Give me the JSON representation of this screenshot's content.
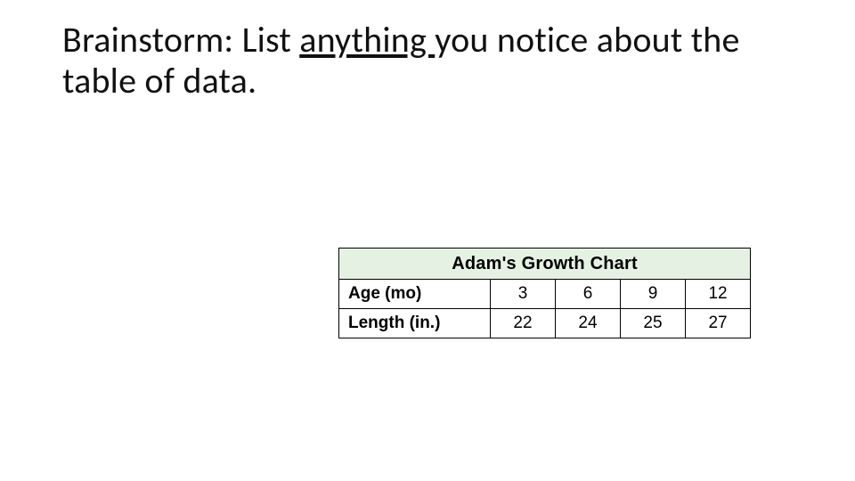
{
  "heading": {
    "prefix": "Brainstorm: List ",
    "underlined": "anything ",
    "suffix": "you notice about the table of data."
  },
  "chart_data": {
    "type": "table",
    "title": "Adam's Growth Chart",
    "row_labels": [
      "Age (mo)",
      "Length (in.)"
    ],
    "columns": [
      3,
      6,
      9,
      12
    ],
    "rows": [
      [
        3,
        6,
        9,
        12
      ],
      [
        22,
        24,
        25,
        27
      ]
    ]
  }
}
